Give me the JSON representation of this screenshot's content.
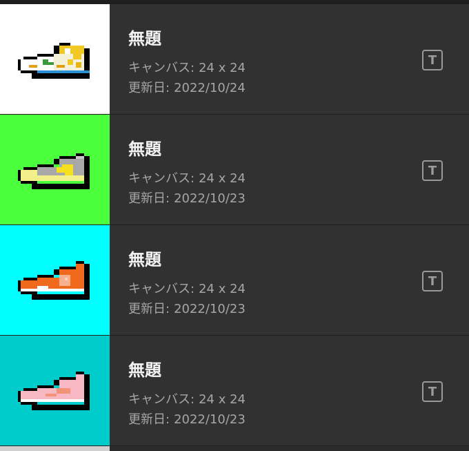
{
  "items": [
    {
      "title": "無題",
      "canvas_label": "キャンバス:",
      "canvas_value": "24 x 24",
      "updated_label": "更新日:",
      "updated_value": "2022/10/24",
      "thumb_bg": "#ffffff",
      "icon": "text-format-icon",
      "shoe": "shoe-white-yellow-pixel-art"
    },
    {
      "title": "無題",
      "canvas_label": "キャンバス:",
      "canvas_value": "24 x 24",
      "updated_label": "更新日:",
      "updated_value": "2022/10/23",
      "thumb_bg": "#4cff3c",
      "icon": "text-format-icon",
      "shoe": "shoe-gray-yellow-pixel-art"
    },
    {
      "title": "無題",
      "canvas_label": "キャンバス:",
      "canvas_value": "24 x 24",
      "updated_label": "更新日:",
      "updated_value": "2022/10/23",
      "thumb_bg": "#00ffff",
      "icon": "text-format-icon",
      "shoe": "shoe-orange-pixel-art"
    },
    {
      "title": "無題",
      "canvas_label": "キャンバス:",
      "canvas_value": "24 x 24",
      "updated_label": "更新日:",
      "updated_value": "2022/10/23",
      "thumb_bg": "#00cccc",
      "icon": "text-format-icon",
      "shoe": "shoe-pink-pixel-art"
    }
  ],
  "icon_glyph": "T",
  "colors": {
    "row_bg": "#313131",
    "text_primary": "#f4f4f4",
    "text_secondary": "#a6a6a6",
    "icon": "#9a9a9a"
  }
}
